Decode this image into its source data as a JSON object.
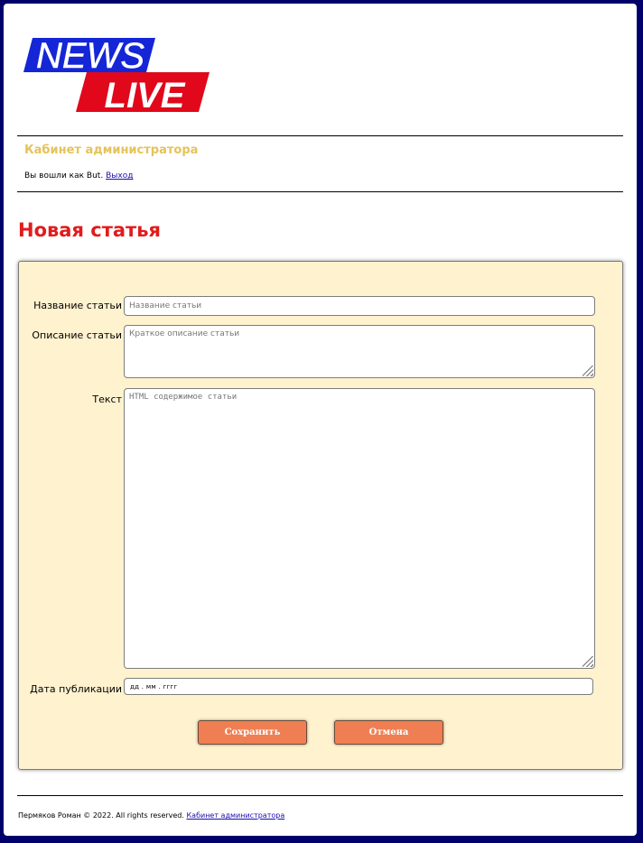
{
  "logo": {
    "word_top": "NEWS",
    "word_bottom": "LIVE",
    "colors": {
      "top": "#1426d6",
      "bottom": "#e0081a"
    }
  },
  "header": {
    "admin_title": "Кабинет администратора",
    "login_prefix": "Вы вошли как",
    "username": "But",
    "login_suffix": ".",
    "logout_link": "Выход"
  },
  "page": {
    "title": "Новая статья"
  },
  "form": {
    "title_label": "Название статьи",
    "title_placeholder": "Название статьи",
    "title_value": "",
    "description_label": "Описание статьи",
    "description_placeholder": "Краткое описание статьи",
    "description_value": "",
    "text_label": "Текст",
    "text_placeholder": "HTML содержимое статьи",
    "text_value": "",
    "date_label": "Дата публикации",
    "date_placeholder": "дд . мм . гггг",
    "save_label": "Сохранить",
    "cancel_label": "Отмена"
  },
  "footer": {
    "copyright": "Пермяков Роман © 2022. All rights reserved.",
    "admin_link": "Кабинет администратора"
  },
  "colors": {
    "frame": "#00006b",
    "admin_title": "#e4c35a",
    "page_title": "#e21b1b",
    "form_bg": "#fff2cf",
    "button": "#ef7f53",
    "link": "#1a0dab"
  }
}
